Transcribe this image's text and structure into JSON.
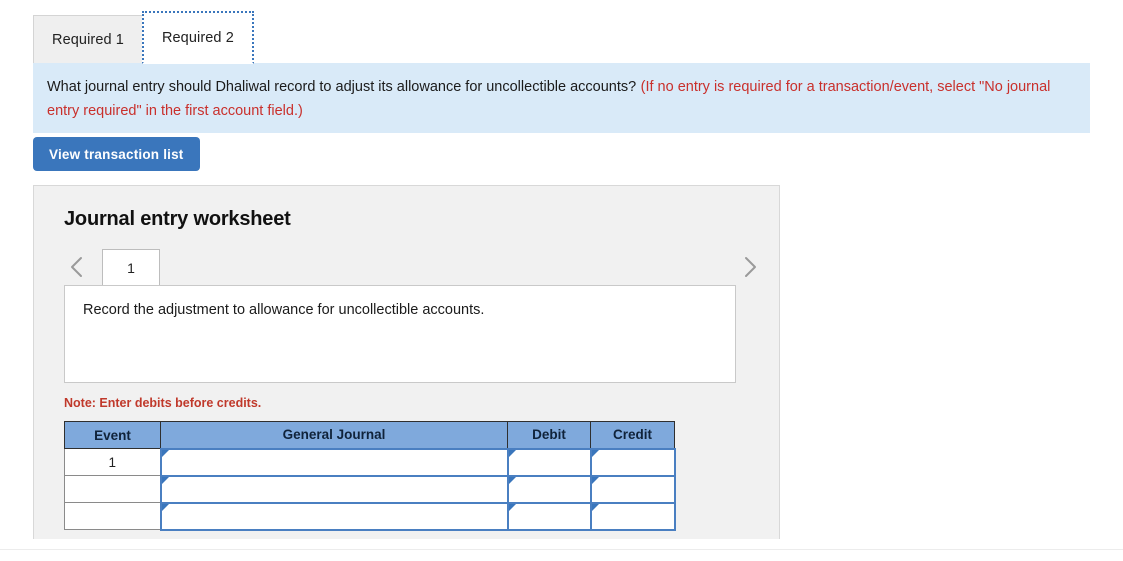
{
  "tabs": [
    {
      "label": "Required 1",
      "active": false
    },
    {
      "label": "Required 2",
      "active": true
    }
  ],
  "question": {
    "text": "What journal entry should Dhaliwal record to adjust its allowance for uncollectible accounts?",
    "hint": "(If no entry is required for a transaction/event, select \"No journal entry required\" in the first account field.)"
  },
  "toolbar": {
    "view_transaction_list_label": "View transaction list"
  },
  "worksheet": {
    "title": "Journal entry worksheet",
    "prev_icon": "chevron-left-icon",
    "next_icon": "chevron-right-icon",
    "page_tab_label": "1",
    "instruction": "Record the adjustment to allowance for uncollectible accounts.",
    "note": "Note: Enter debits before credits.",
    "table": {
      "headers": [
        "Event",
        "General Journal",
        "Debit",
        "Credit"
      ],
      "rows": [
        {
          "event": "1",
          "general_journal": "",
          "debit": "",
          "credit": ""
        },
        {
          "event": "",
          "general_journal": "",
          "debit": "",
          "credit": ""
        },
        {
          "event": "",
          "general_journal": "",
          "debit": "",
          "credit": ""
        }
      ]
    }
  },
  "colors": {
    "banner_bg": "#d9eaf8",
    "button_blue": "#3a76bc",
    "header_blue": "#7fa9dc",
    "note_red": "#c0392b",
    "panel_gray": "#f1f1f1"
  }
}
